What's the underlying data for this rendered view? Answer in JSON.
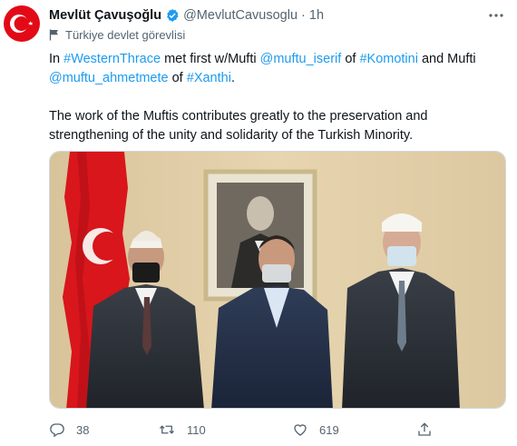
{
  "tweet": {
    "author_name": "Mevlüt Çavuşoğlu",
    "handle": "@MevlutCavusoglu",
    "separator": "·",
    "time": "1h",
    "account_label": "Türkiye devlet görevlisi",
    "more_icon": "more-icon",
    "paragraph1": [
      {
        "text": "In ",
        "link": false
      },
      {
        "text": "#WesternThrace",
        "link": true
      },
      {
        "text": " met first w/Mufti ",
        "link": false
      },
      {
        "text": "@muftu_iserif",
        "link": true
      },
      {
        "text": " of ",
        "link": false
      },
      {
        "text": "#Komotini",
        "link": true
      },
      {
        "text": " and Mufti ",
        "link": false
      },
      {
        "text": "@muftu_ahmetmete",
        "link": true
      },
      {
        "text": " of ",
        "link": false
      },
      {
        "text": "#Xanthi",
        "link": true
      },
      {
        "text": ".",
        "link": false
      }
    ],
    "paragraph2": "The work of the Muftis contributes greatly to the preservation and strengthening of the unity and solidarity of the Turkish Minority.",
    "actions": {
      "replies": "38",
      "retweets": "110",
      "likes": "619"
    },
    "colors": {
      "link": "#1d9bf0",
      "muted": "#536471",
      "verified": "#1d9bf0",
      "flag_red": "#e30a17"
    }
  }
}
